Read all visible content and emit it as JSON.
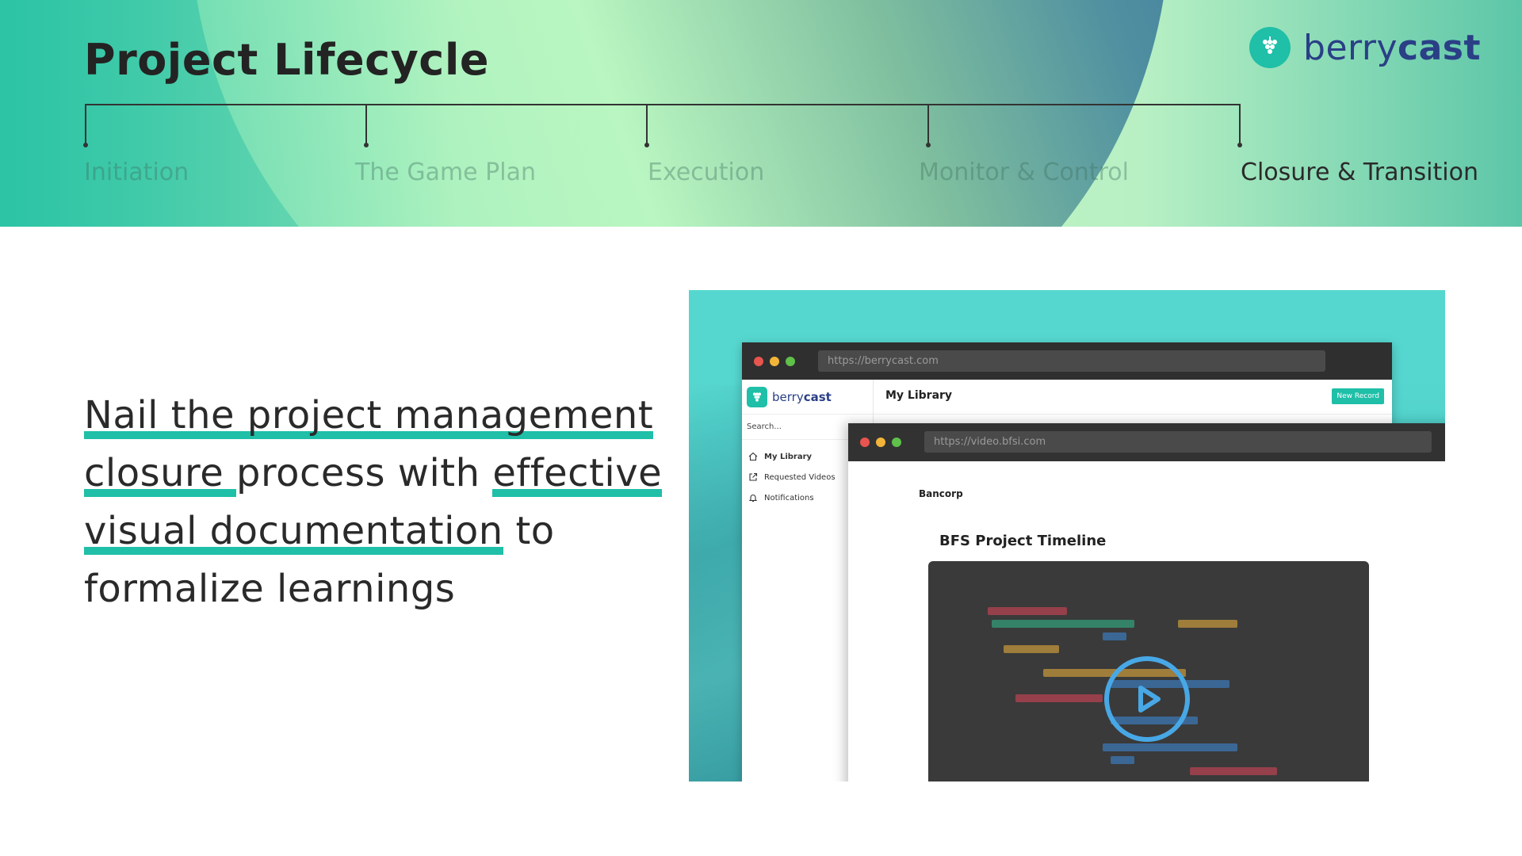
{
  "header": {
    "title": "Project Lifecycle",
    "logo": {
      "prefix": "berry",
      "suffix": "cast",
      "icon": "berry-icon"
    },
    "phases": [
      {
        "label": "Initiation",
        "active": false
      },
      {
        "label": "The Game Plan",
        "active": false
      },
      {
        "label": "Execution",
        "active": false
      },
      {
        "label": "Monitor & Control",
        "active": false
      },
      {
        "label": "Closure & Transition",
        "active": true
      }
    ]
  },
  "headline": {
    "seg1": "Nail the project management",
    "seg2": "closure ",
    "seg3": "process with ",
    "seg4": "effective",
    "seg5": "visual documentation",
    "seg6": " to",
    "seg7": "formalize learnings"
  },
  "screenshot": {
    "window1": {
      "url": "https://berrycast.com",
      "logo_prefix": "berry",
      "logo_suffix": "cast",
      "search": "Search...",
      "nav": [
        {
          "label": "My Library",
          "icon": "home-icon",
          "active": true
        },
        {
          "label": "Requested Videos",
          "icon": "external-link-icon",
          "active": false
        },
        {
          "label": "Notifications",
          "icon": "bell-icon",
          "active": false
        }
      ],
      "page_title": "My Library",
      "new_record": "New Record"
    },
    "window2": {
      "url": "https://video.bfsi.com",
      "company": "Bancorp",
      "video_title": "BFS Project Timeline",
      "play_icon": "play-icon"
    }
  },
  "colors": {
    "accent": "#1fbfa8",
    "brand_text": "#2a3f86",
    "title": "#232323"
  }
}
